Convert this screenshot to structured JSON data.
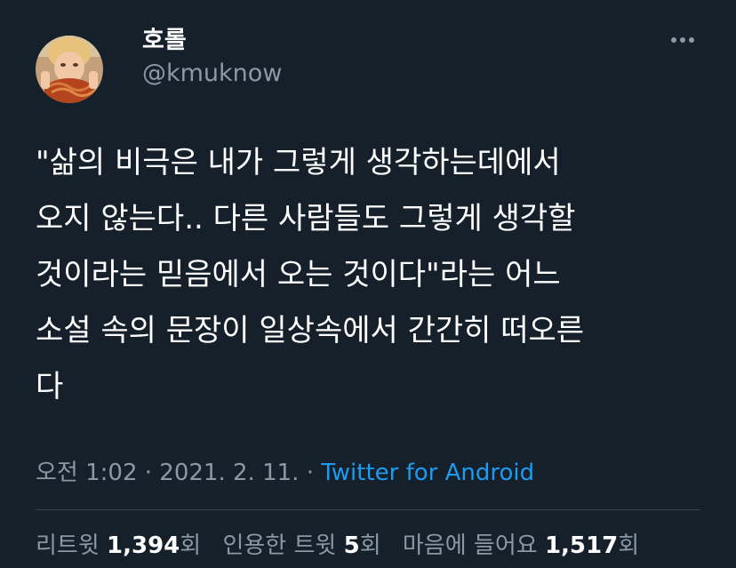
{
  "author": {
    "display_name": "호롤",
    "handle": "@kmuknow"
  },
  "tweet": {
    "lines": [
      "\"삶의 비극은 내가 그렇게 생각하는데에서",
      "오지 않는다.. 다른 사람들도 그렇게 생각할",
      "것이라는 믿음에서 오는 것이다\"라는 어느",
      "소설 속의 문장이 일상속에서 간간히 떠오른",
      "다"
    ],
    "time": "오전 1:02",
    "date": "2021. 2. 11.",
    "separator": "·",
    "source": "Twitter for Android"
  },
  "stats": {
    "retweets_label": "리트윗",
    "retweets_count": "1,394",
    "retweets_unit": "회",
    "quotes_label": "인용한 트윗",
    "quotes_count": "5",
    "quotes_unit": "회",
    "likes_label": "마음에 들어요",
    "likes_count": "1,517",
    "likes_unit": "회"
  },
  "icons": {
    "more": "more-horizontal-icon",
    "avatar": "profile-avatar"
  },
  "colors": {
    "background": "#15202b",
    "primary_text": "#ffffff",
    "secondary_text": "#8b98a5",
    "link": "#1d9bf0",
    "divider": "#38444d"
  }
}
